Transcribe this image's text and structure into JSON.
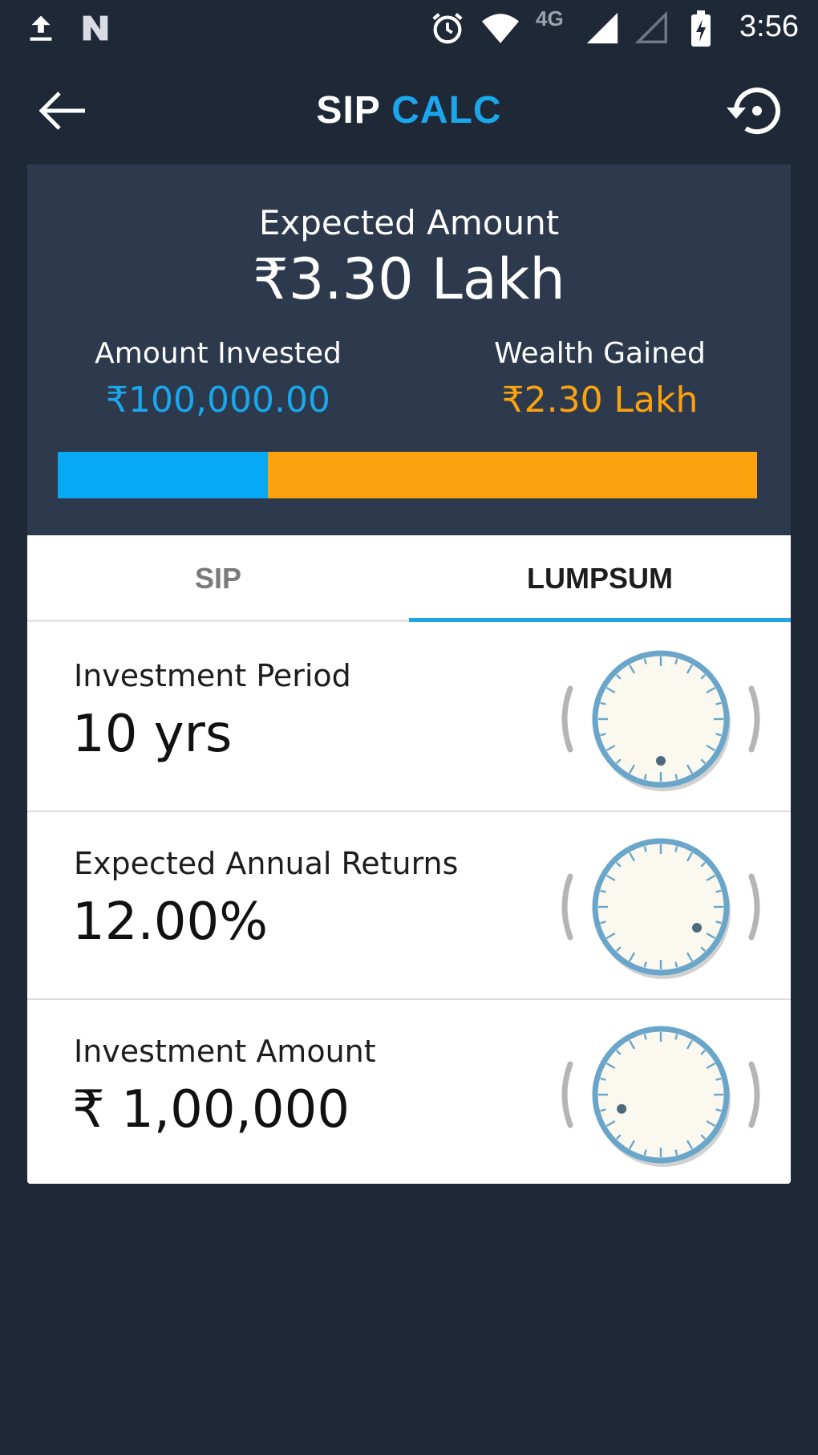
{
  "status_bar": {
    "time": "3:56",
    "network": "4G",
    "icons": [
      "upload-icon",
      "n-notification-icon",
      "alarm-icon",
      "wifi-icon",
      "signal-icon",
      "signal-empty-icon",
      "battery-charging-icon"
    ]
  },
  "header": {
    "title_part1": "SIP",
    "title_part2": "CALC",
    "back_icon": "arrow-left-icon",
    "reset_icon": "history-reset-icon"
  },
  "summary": {
    "expected_label": "Expected Amount",
    "expected_value": "₹3.30 Lakh",
    "invested_label": "Amount Invested",
    "invested_value": "₹100,000.00",
    "gained_label": "Wealth Gained",
    "gained_value": "₹2.30 Lakh",
    "invested_fraction": 0.3
  },
  "tabs": [
    {
      "label": "SIP",
      "active": false
    },
    {
      "label": "LUMPSUM",
      "active": true
    }
  ],
  "inputs": [
    {
      "label": "Investment Period",
      "value": "10 yrs"
    },
    {
      "label": "Expected Annual Returns",
      "value": "12.00%"
    },
    {
      "label": "Investment Amount",
      "value": "₹ 1,00,000"
    }
  ],
  "colors": {
    "background": "#1f2837",
    "summary_bg": "#2d3a4e",
    "accent_blue": "#1aa7ec",
    "invested_blue": "#06a9f4",
    "gained_orange": "#fca20e"
  }
}
